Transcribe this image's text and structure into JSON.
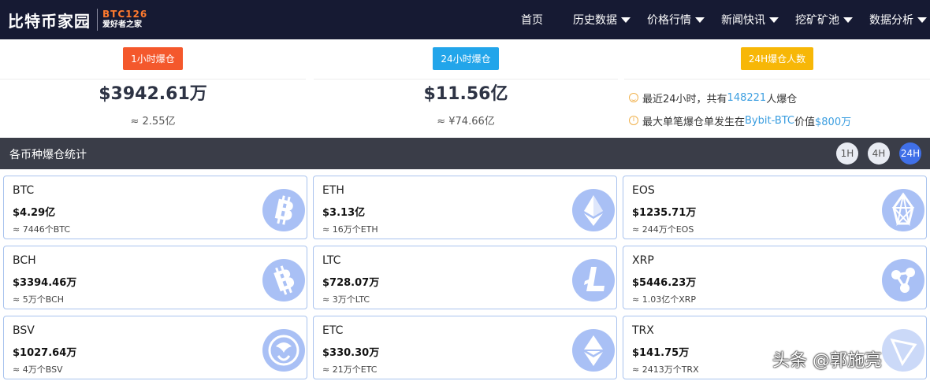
{
  "brand": {
    "name": "比特币家园",
    "code": "BTC126",
    "slogan": "爱好者之家"
  },
  "nav": [
    {
      "label": "首页",
      "dropdown": false
    },
    {
      "label": "历史数据",
      "dropdown": true
    },
    {
      "label": "价格行情",
      "dropdown": true
    },
    {
      "label": "新闻快讯",
      "dropdown": true
    },
    {
      "label": "挖矿矿池",
      "dropdown": true
    },
    {
      "label": "数据分析",
      "dropdown": true
    }
  ],
  "stats": [
    {
      "badge": "1小时爆仓",
      "badge_color": "#f4582c",
      "value": "$3942.61万",
      "sub": "≈ 2.55亿"
    },
    {
      "badge": "24小时爆仓",
      "badge_color": "#22a5ea",
      "value": "$11.56亿",
      "sub": "≈ ¥74.66亿"
    },
    {
      "badge": "24H爆仓人数",
      "badge_color": "#f7b707"
    }
  ],
  "summary": {
    "line1_prefix": "最近24小时，共有",
    "line1_count": "148221",
    "line1_suffix": "人爆仓",
    "line2_prefix": "最大单笔爆仓单发生在",
    "line2_exchange": "Bybit-BTC",
    "line2_mid": "价值",
    "line2_value": "$800万"
  },
  "section": {
    "title": "各币种爆仓统计",
    "timeframes": [
      "1H",
      "4H",
      "24H"
    ],
    "active_timeframe": "24H"
  },
  "coins": [
    {
      "symbol": "BTC",
      "amount": "$4.29亿",
      "qty": "≈ 7446个BTC",
      "icon": "bitcoin-icon"
    },
    {
      "symbol": "ETH",
      "amount": "$3.13亿",
      "qty": "≈ 16万个ETH",
      "icon": "ethereum-icon"
    },
    {
      "symbol": "EOS",
      "amount": "$1235.71万",
      "qty": "≈ 244万个EOS",
      "icon": "eos-icon"
    },
    {
      "symbol": "BCH",
      "amount": "$3394.46万",
      "qty": "≈ 5万个BCH",
      "icon": "bitcoin-cash-icon"
    },
    {
      "symbol": "LTC",
      "amount": "$728.07万",
      "qty": "≈ 3万个LTC",
      "icon": "litecoin-icon"
    },
    {
      "symbol": "XRP",
      "amount": "$5446.23万",
      "qty": "≈ 1.03亿个XRP",
      "icon": "ripple-icon"
    },
    {
      "symbol": "BSV",
      "amount": "$1027.64万",
      "qty": "≈ 4万个BSV",
      "icon": "bitcoin-sv-icon"
    },
    {
      "symbol": "ETC",
      "amount": "$330.30万",
      "qty": "≈ 21万个ETC",
      "icon": "ethereum-classic-icon"
    },
    {
      "symbol": "TRX",
      "amount": "$141.75万",
      "qty": "≈ 2413万个TRX",
      "icon": "tron-icon"
    }
  ],
  "watermark": "头条 @郭施亮"
}
